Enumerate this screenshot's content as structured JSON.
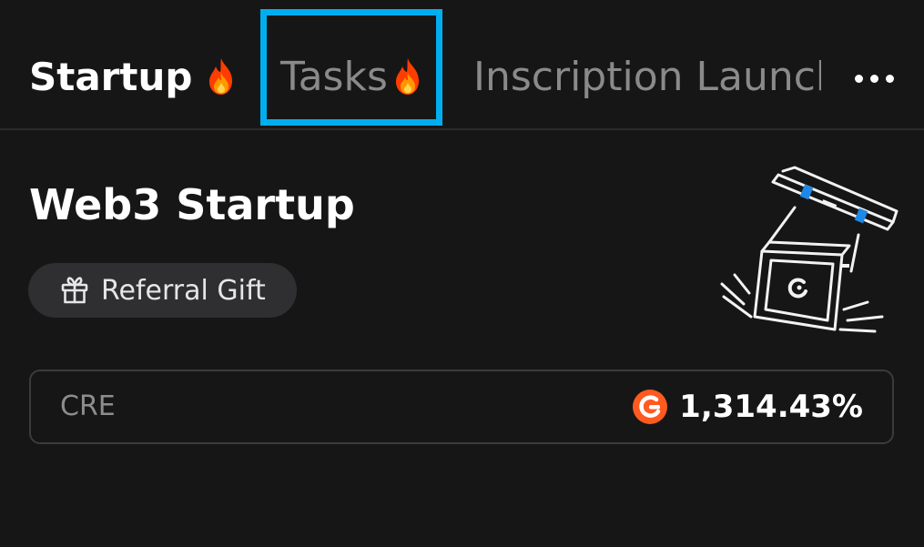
{
  "tabs": {
    "startup_label": "Startup",
    "tasks_label": "Tasks",
    "inscription_label": "Inscription Launch",
    "more_icon": "more-horizontal-icon",
    "fire_icon": "fire-icon",
    "highlight_color": "#00aeef"
  },
  "main": {
    "title": "Web3 Startup",
    "referral_label": "Referral Gift",
    "referral_icon": "gift-icon",
    "illustration": "falling-box-illustration",
    "token": {
      "name": "CRE",
      "value": "1,314.43%",
      "icon": "cre-token-icon",
      "icon_color": "#ff5a1f"
    }
  }
}
